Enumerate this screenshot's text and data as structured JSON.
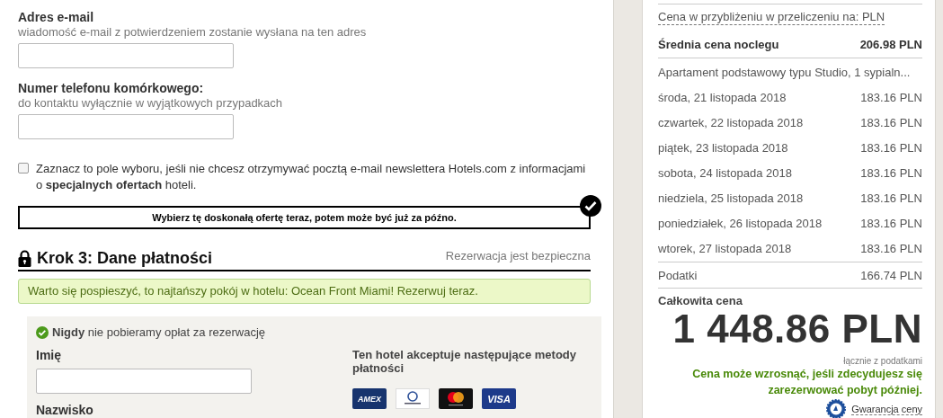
{
  "contact": {
    "email": {
      "label": "Adres e-mail",
      "hint": "wiadomość e-mail z potwierdzeniem zostanie wysłana na ten adres"
    },
    "phone": {
      "label": "Numer telefonu komórkowego:",
      "hint": "do kontaktu wyłącznie w wyjątkowych przypadkach"
    },
    "newsletter": {
      "checked": false,
      "text": "Zaznacz to pole wyboru, jeśli nie chcesz otrzymywać pocztą e-mail newslettera Hotels.com z informacjami o **specjalnych ofertach** hoteli."
    }
  },
  "offer_banner": {
    "text": "Wybierz tę doskonałą ofertę teraz, potem może być już za późno.",
    "checked": true
  },
  "step": {
    "title": "Krok 3: Dane płatności",
    "secure": "Rezerwacja jest bezpieczna"
  },
  "notice": "Warto się pospieszyć, to najtańszy pokój w hotelu: Ocean Front Miami! Rezerwuj teraz.",
  "payment": {
    "no_fee": "**Nigdy** nie pobieramy opłat za rezerwację",
    "first_name": {
      "label": "Imię"
    },
    "last_name": {
      "label": "Nazwisko"
    },
    "methods_title": "Ten hotel akceptuje następujące metody płatności",
    "cards": [
      {
        "kind": "amex",
        "label": "AMEX"
      },
      {
        "kind": "diners"
      },
      {
        "kind": "mastercard"
      },
      {
        "kind": "visa",
        "label": "VISA"
      }
    ]
  },
  "summary": {
    "currency_note": "Cena w przybliżeniu w przeliczeniu na: PLN",
    "average": {
      "label": "Średnia cena noclegu",
      "amount": "206.98 PLN"
    },
    "room": "Apartament podstawowy typu Studio, 1 sypialn...",
    "nights": [
      {
        "date": "środa, 21 listopada 2018",
        "amount": "183.16 PLN"
      },
      {
        "date": "czwartek, 22 listopada 2018",
        "amount": "183.16 PLN"
      },
      {
        "date": "piątek, 23 listopada 2018",
        "amount": "183.16 PLN"
      },
      {
        "date": "sobota, 24 listopada 2018",
        "amount": "183.16 PLN"
      },
      {
        "date": "niedziela, 25 listopada 2018",
        "amount": "183.16 PLN"
      },
      {
        "date": "poniedziałek, 26 listopada 2018",
        "amount": "183.16 PLN"
      },
      {
        "date": "wtorek, 27 listopada 2018",
        "amount": "183.16 PLN"
      }
    ],
    "taxes": {
      "label": "Podatki",
      "amount": "166.74 PLN"
    },
    "total_label": "Całkowita cena",
    "total": "1 448.86 PLN",
    "tax_note": "łącznie z podatkami",
    "warning": "Cena może wzrosnąć, jeśli zdecydujesz się zarezerwować pobyt później.",
    "guarantee": "Gwarancja ceny"
  }
}
